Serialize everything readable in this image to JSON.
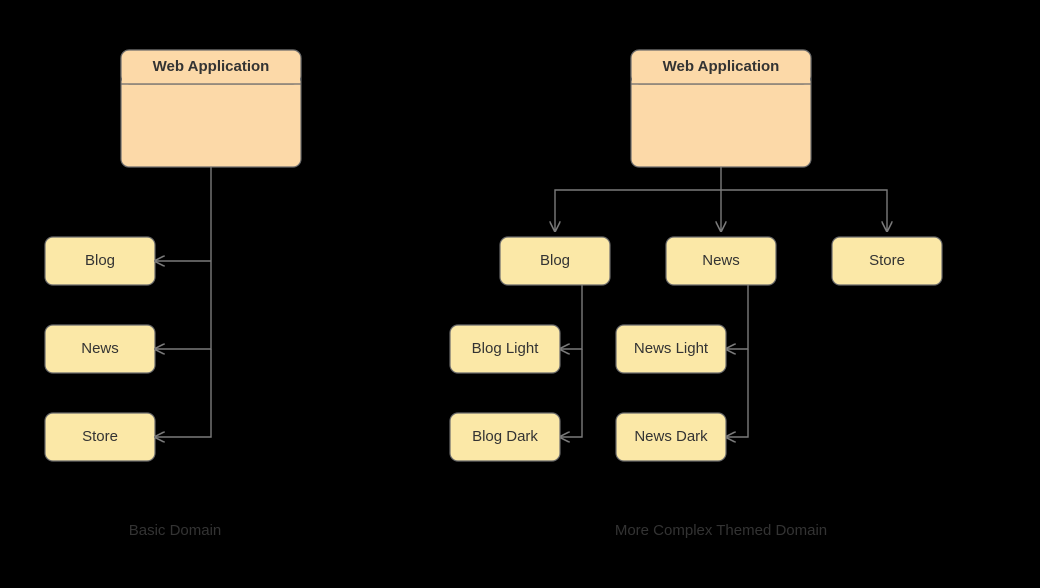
{
  "left": {
    "parent": {
      "title": "Web Application"
    },
    "children": [
      "Blog",
      "News",
      "Store"
    ],
    "caption": "Basic Domain"
  },
  "right": {
    "parent": {
      "title": "Web Application"
    },
    "children": [
      "Blog",
      "News",
      "Store"
    ],
    "grandchildren": {
      "blog": [
        "Blog Light",
        "Blog Dark"
      ],
      "news": [
        "News Light",
        "News Dark"
      ]
    },
    "caption": "More Complex Themed Domain"
  }
}
